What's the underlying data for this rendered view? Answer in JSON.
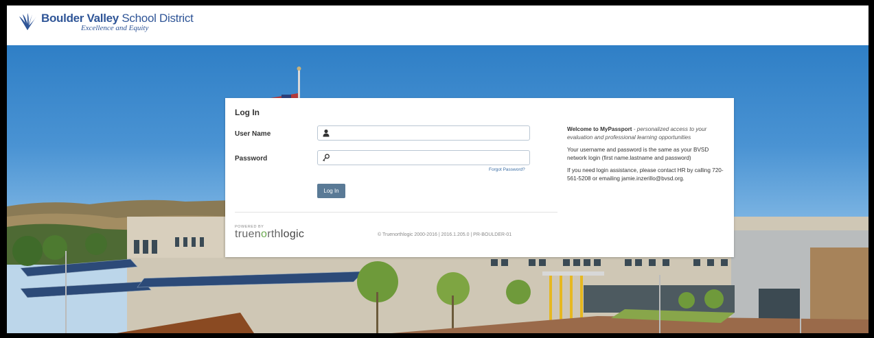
{
  "header": {
    "logo_name_bold": "Boulder Valley",
    "logo_name_rest": " School District",
    "logo_tagline": "Excellence and Equity",
    "logo_icon": "bvsd-leaf-icon"
  },
  "login": {
    "title": "Log In",
    "username_label": "User Name",
    "username_value": "",
    "username_icon": "user-icon",
    "password_label": "Password",
    "password_value": "",
    "password_icon": "key-icon",
    "forgot_link": "Forgot Password?",
    "submit_label": "Log In"
  },
  "footer": {
    "powered_by": "POWERED BY",
    "brand_true": "true",
    "brand_n": "n",
    "brand_o": "o",
    "brand_rth": "rth",
    "brand_logic": "logic",
    "copyright": "© Truenorthlogic 2000-2016 | 2016.1.205.0 | PR-BOULDER-01"
  },
  "info": {
    "welcome_bold": "Welcome to MyPassport",
    "welcome_rest": " - personalized access to your evaluation and professional learning opportunities",
    "credentials": "Your username and password is the same as your BVSD network login (first name.lastname and password)",
    "assistance": "If you need login assistance, please contact HR by calling 720-561-5208 or emailing jamie.inzerillo@bvsd.org."
  },
  "colors": {
    "brand_blue": "#2f5597",
    "button": "#5a7a96",
    "link": "#3b6ea5",
    "accent_green": "#6aa84f"
  }
}
